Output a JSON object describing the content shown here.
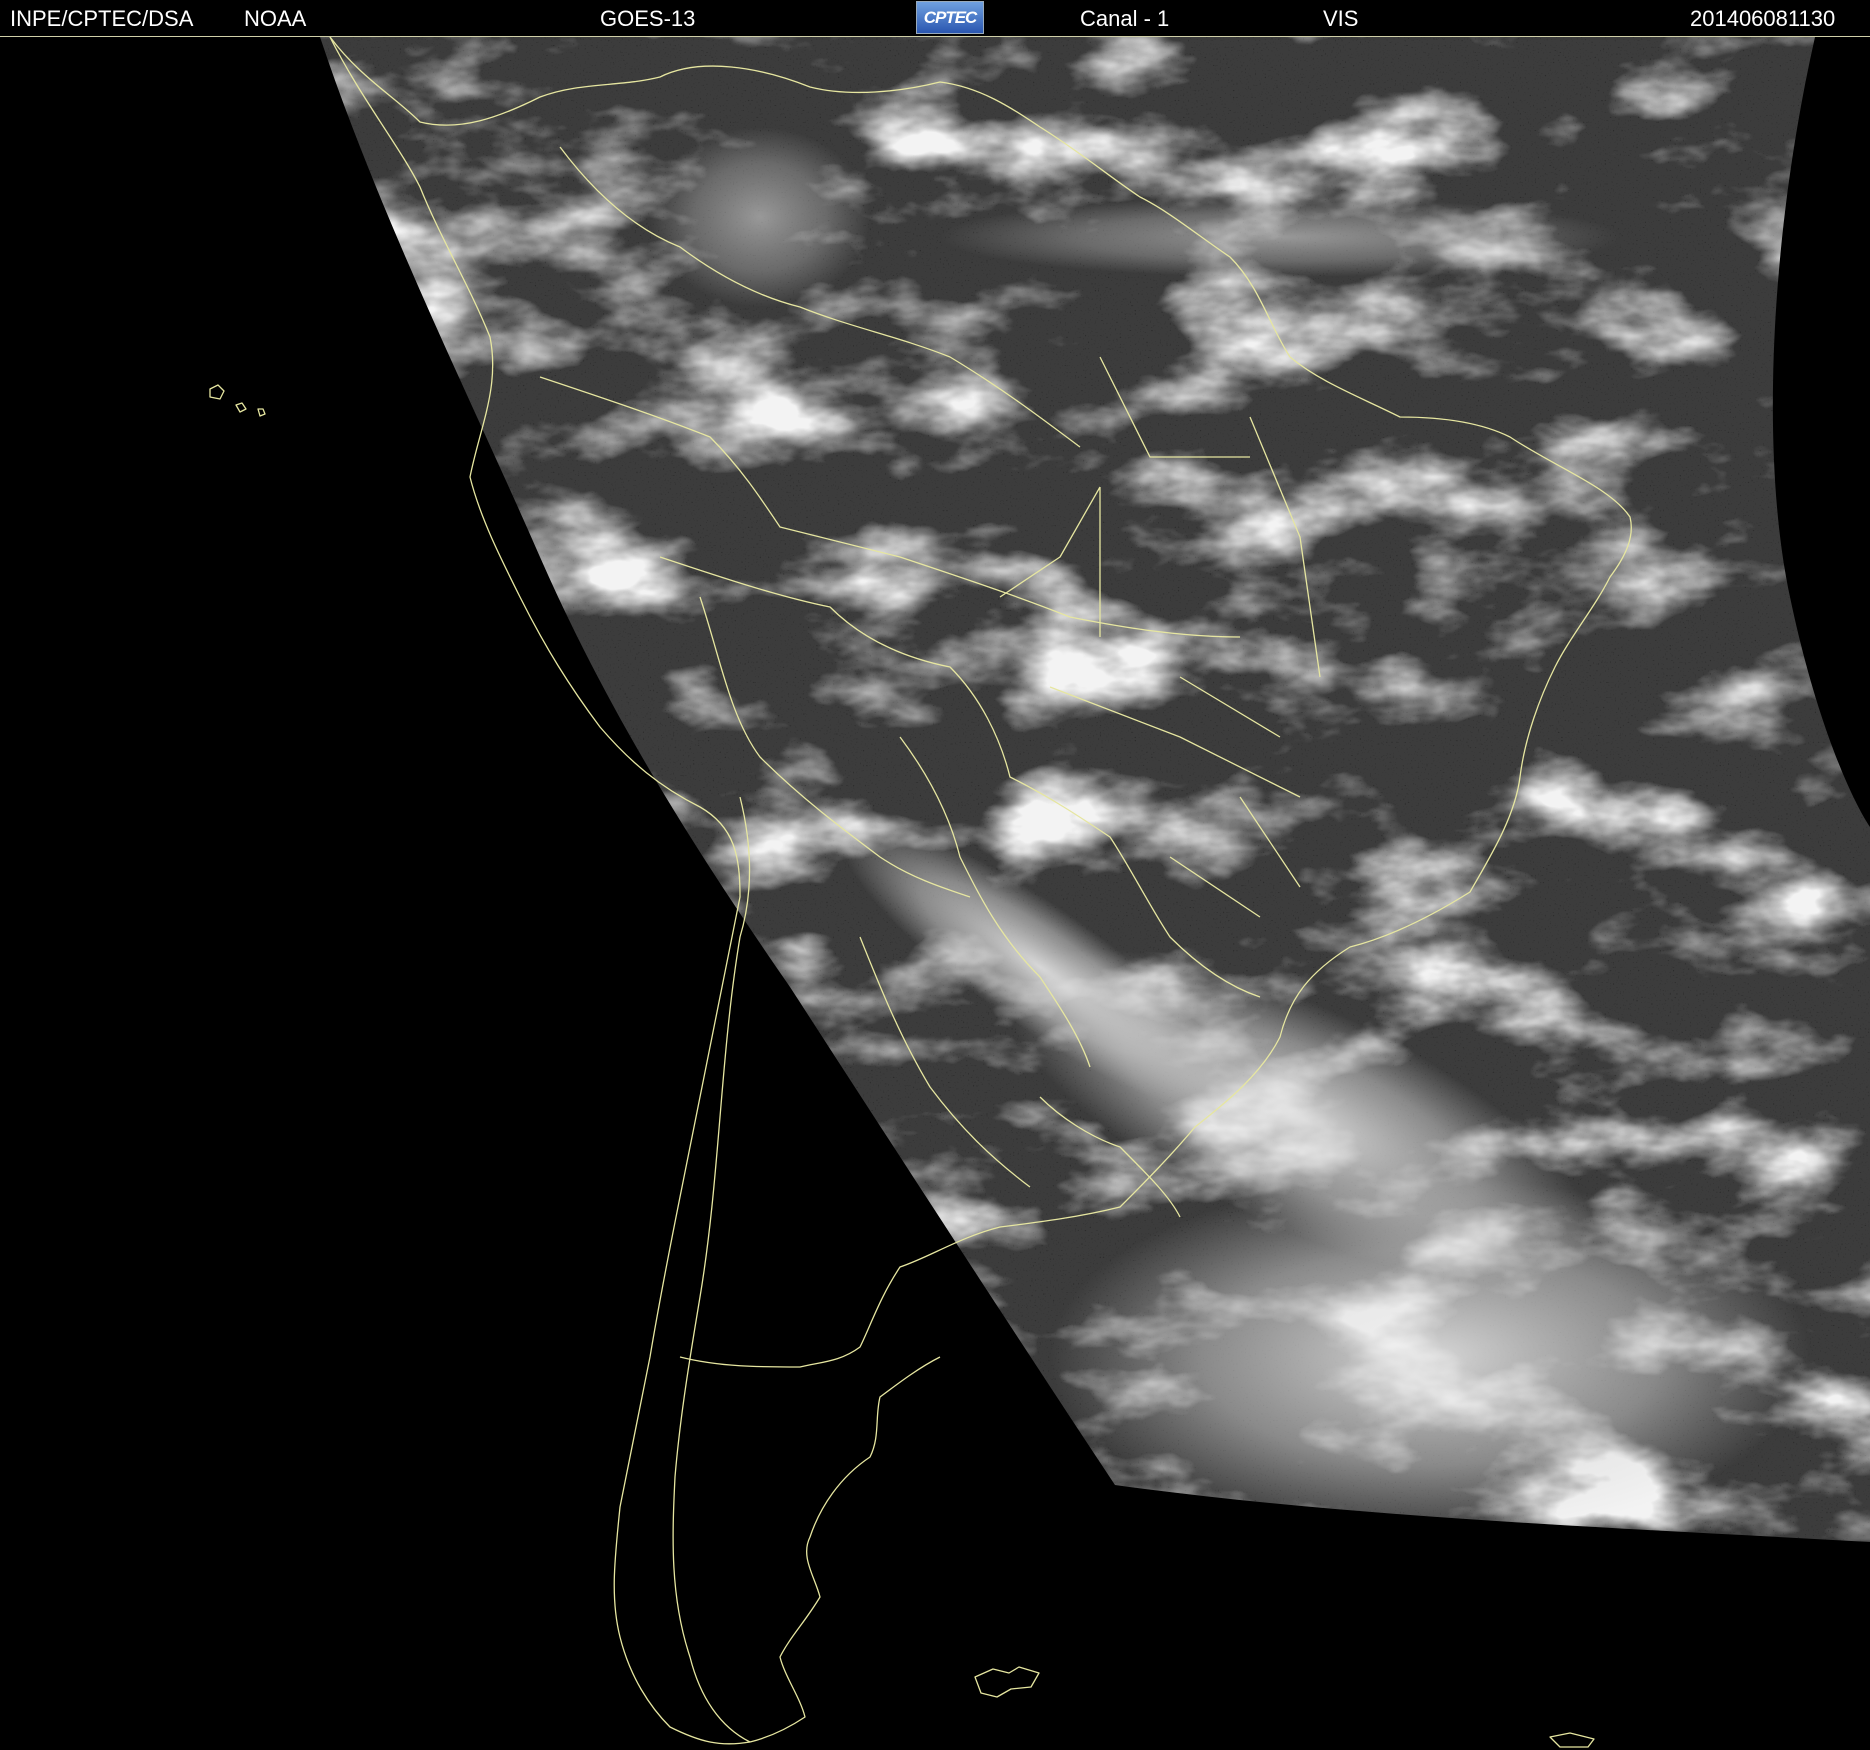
{
  "header": {
    "institution": "INPE/CPTEC/DSA",
    "agency": "NOAA",
    "satellite": "GOES-13",
    "logo_text": "CPTEC",
    "channel": "Canal - 1",
    "band": "VIS",
    "timestamp": "201406081130"
  },
  "map": {
    "imagery_type": "satellite-visible",
    "region": "South America",
    "colors": {
      "background": "#000000",
      "cloud": "#e8e8e8",
      "land": "#3a3a3a",
      "borders": "#e6e6a0"
    }
  }
}
